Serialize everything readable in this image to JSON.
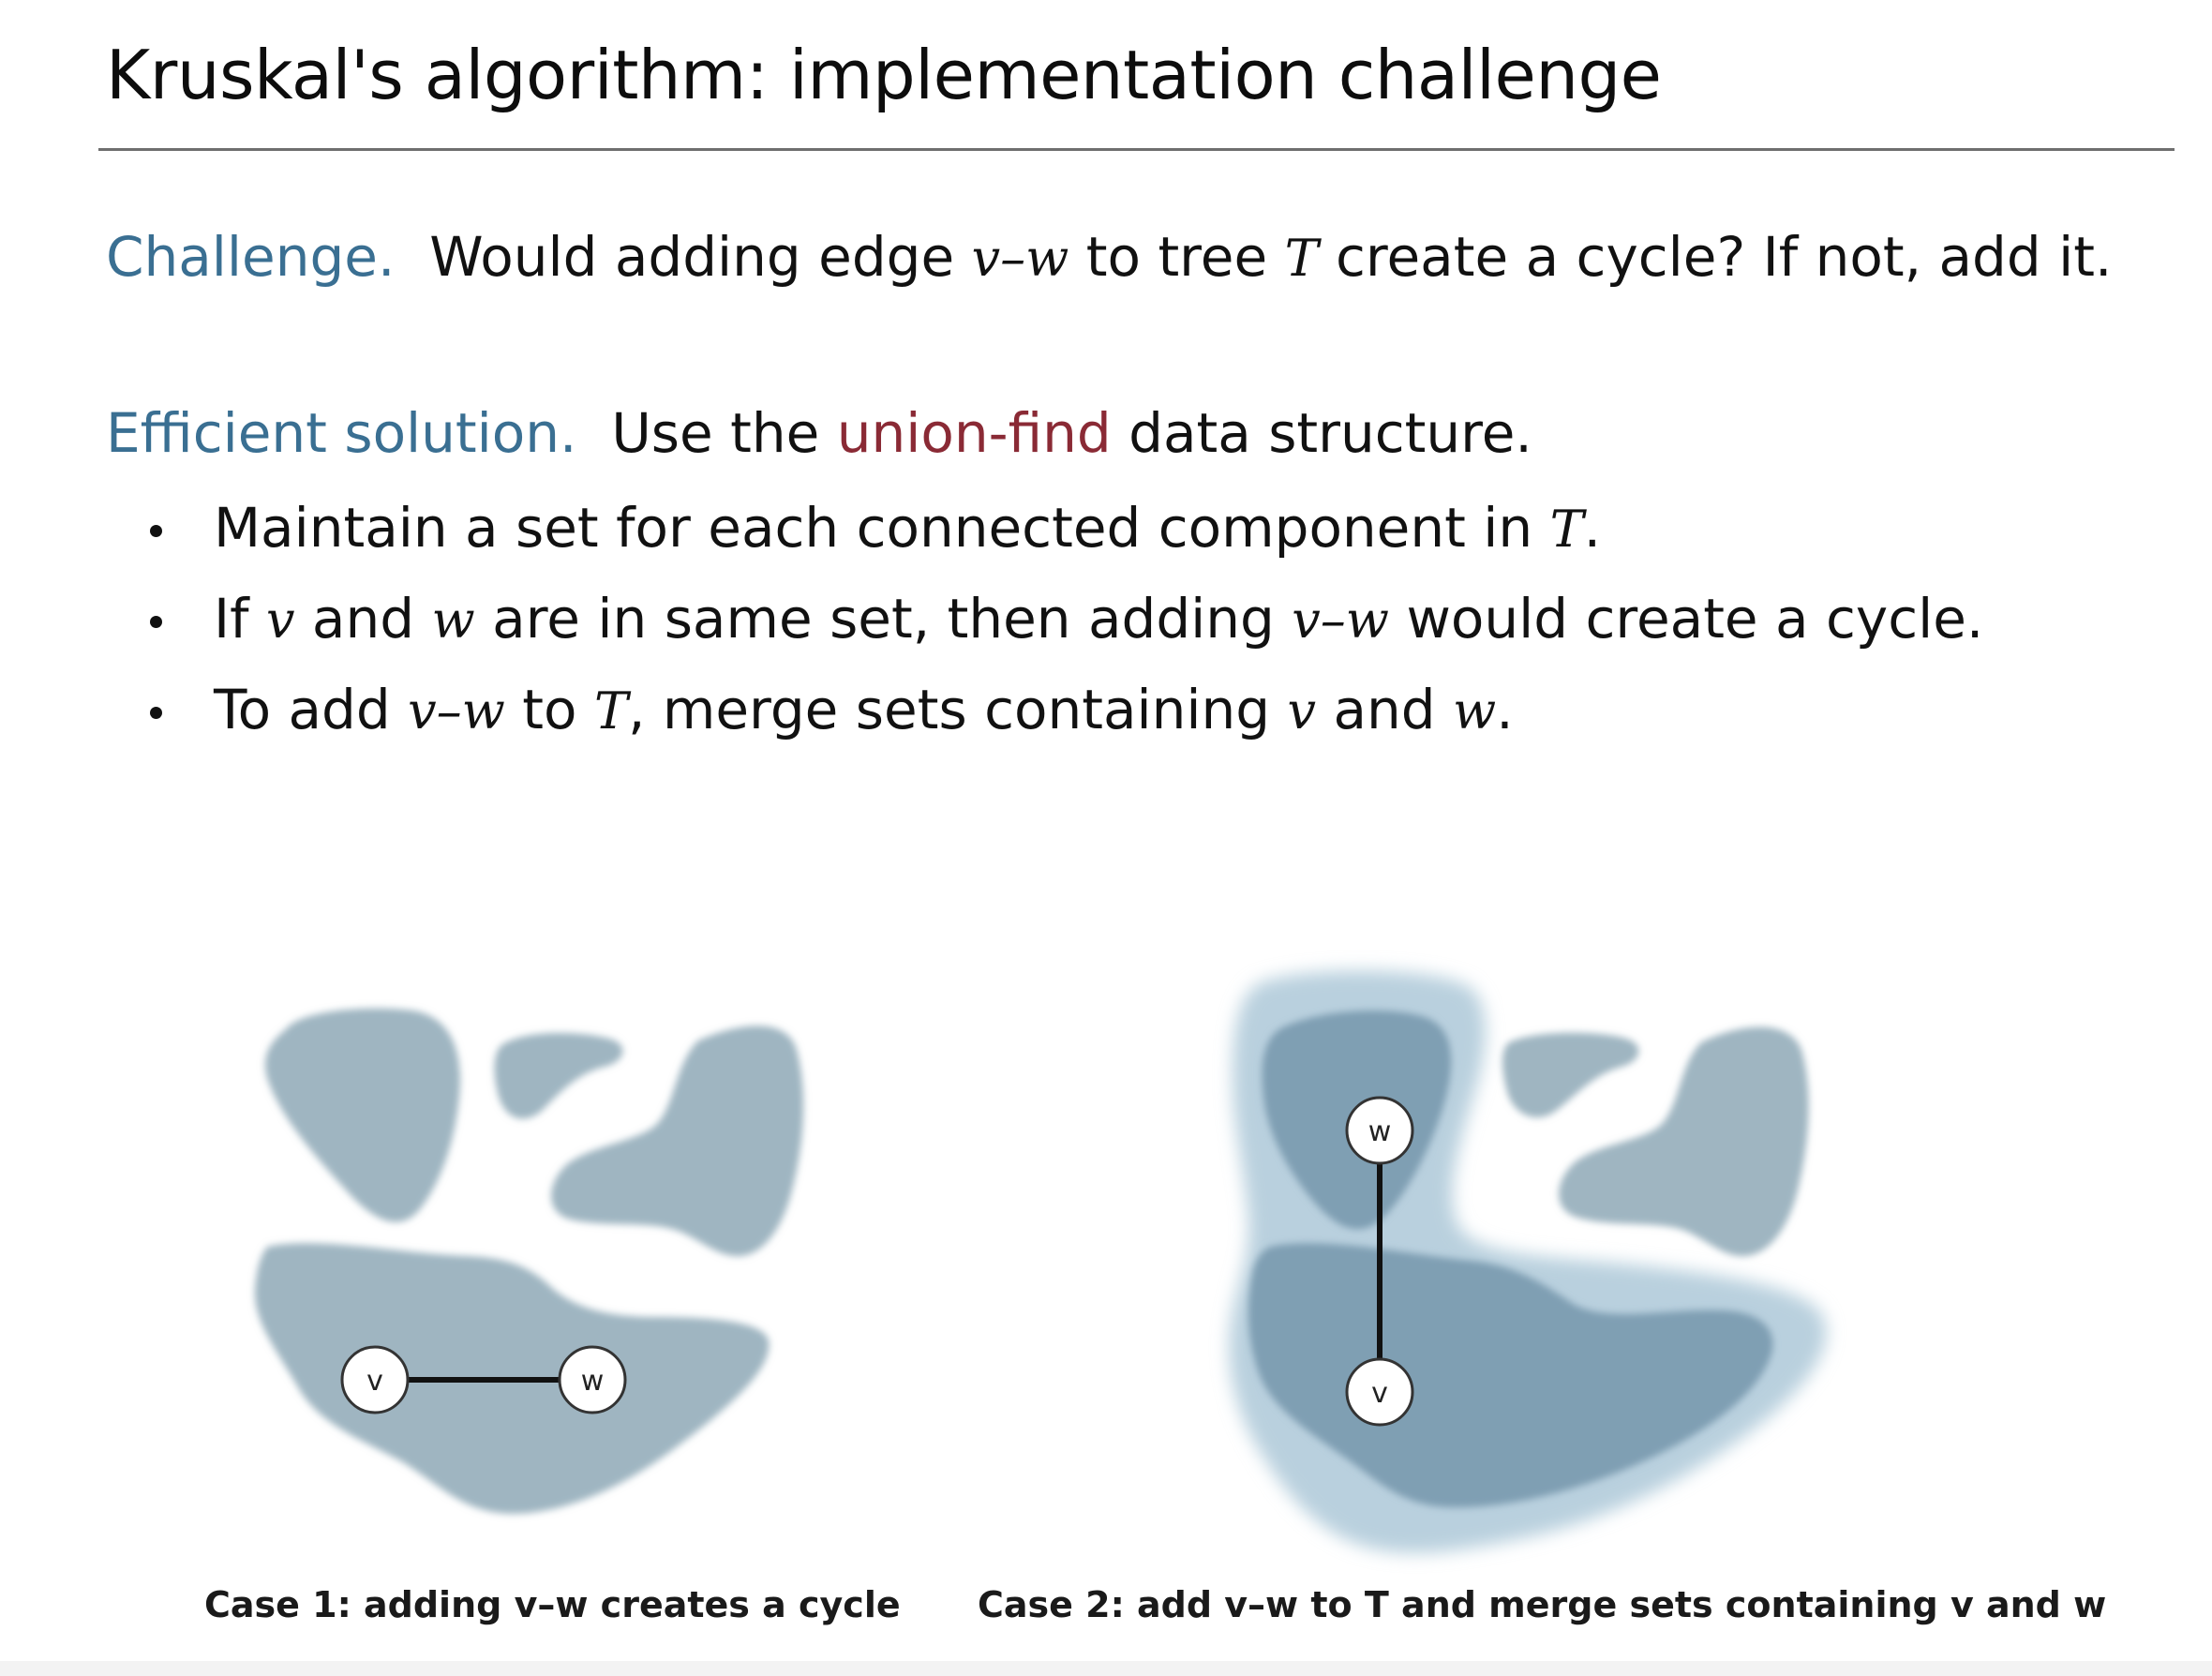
{
  "title": "Kruskal's algorithm:  implementation challenge",
  "challenge": {
    "lead": "Challenge.",
    "t1": "Would adding edge",
    "edge": "v–w",
    "t2": "to tree",
    "tree": "T",
    "t3": "create a cycle? If not, add it."
  },
  "solution": {
    "lead": "Efficient solution.",
    "t1": "Use the",
    "highlight": "union-find",
    "t2": "data structure."
  },
  "bullets": [
    {
      "t1": "Maintain a set for each connected component in",
      "m1": "T",
      "t2": "."
    },
    {
      "t1": "If",
      "m1": "v",
      "t2": "and",
      "m2": "w",
      "t3": "are in same set, then adding",
      "m3": "v–w",
      "t4": "would create a cycle."
    },
    {
      "t1": "To add",
      "m1": "v–w",
      "t2": "to",
      "m2": "T",
      "t3": ", merge sets containing",
      "m3": "v",
      "t4": "and",
      "m4": "w",
      "t5": "."
    }
  ],
  "figure": {
    "colors": {
      "blob": "#9fb5c1",
      "merged_outer": "#b9d0de",
      "merged_inner": "#7f9fb3",
      "edge": "#111111",
      "node_fill": "#ffffff"
    },
    "case1": {
      "node_v": "v",
      "node_w": "w",
      "caption": "Case 1: adding v–w creates a cycle"
    },
    "case2": {
      "node_v": "v",
      "node_w": "w",
      "caption": "Case 2: add v–w to T and merge sets containing v and w"
    }
  }
}
